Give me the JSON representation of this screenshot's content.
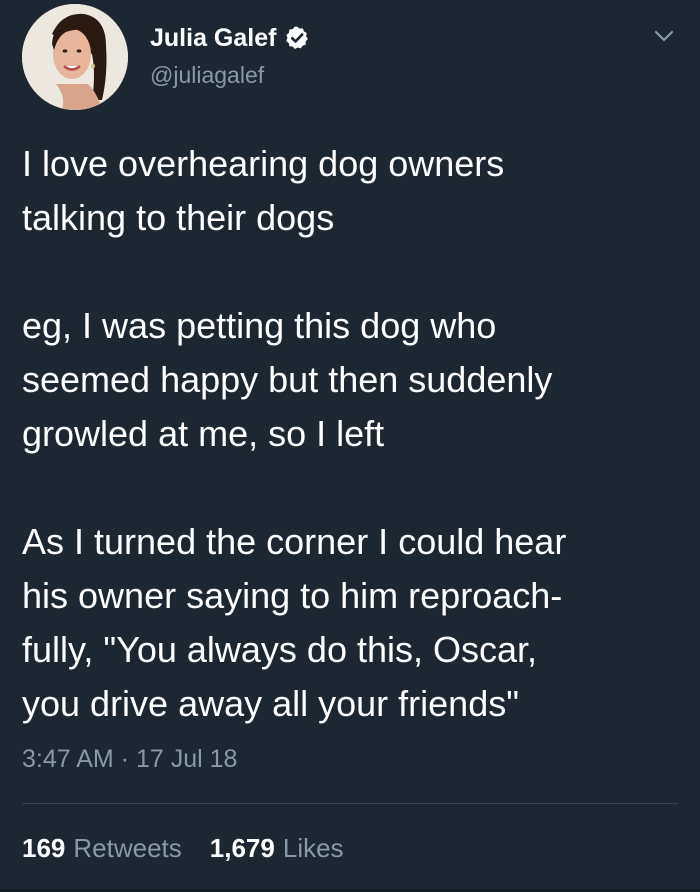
{
  "author": {
    "display_name": "Julia Galef",
    "handle": "@juliagalef",
    "verified": true
  },
  "tweet": {
    "paragraphs": [
      "I love overhearing dog owners\ntalking to their dogs",
      "eg, I was petting this dog who\nseemed happy but then suddenly\ngrowled at me, so I left",
      "As I turned the corner I could hear\nhis owner saying to him reproach-\nfully, \"You always do this, Oscar,\nyou drive away all your friends\""
    ],
    "timestamp": "3:47 AM · 17 Jul 18"
  },
  "stats": {
    "retweets_count": "169",
    "retweets_label": "Retweets",
    "likes_count": "1,679",
    "likes_label": "Likes"
  },
  "icons": {
    "verified": "verified-badge-icon",
    "menu": "chevron-down-icon"
  },
  "colors": {
    "background": "#1c2732",
    "text_primary": "#ffffff",
    "text_secondary": "#8899a6",
    "divider": "#38444d"
  }
}
